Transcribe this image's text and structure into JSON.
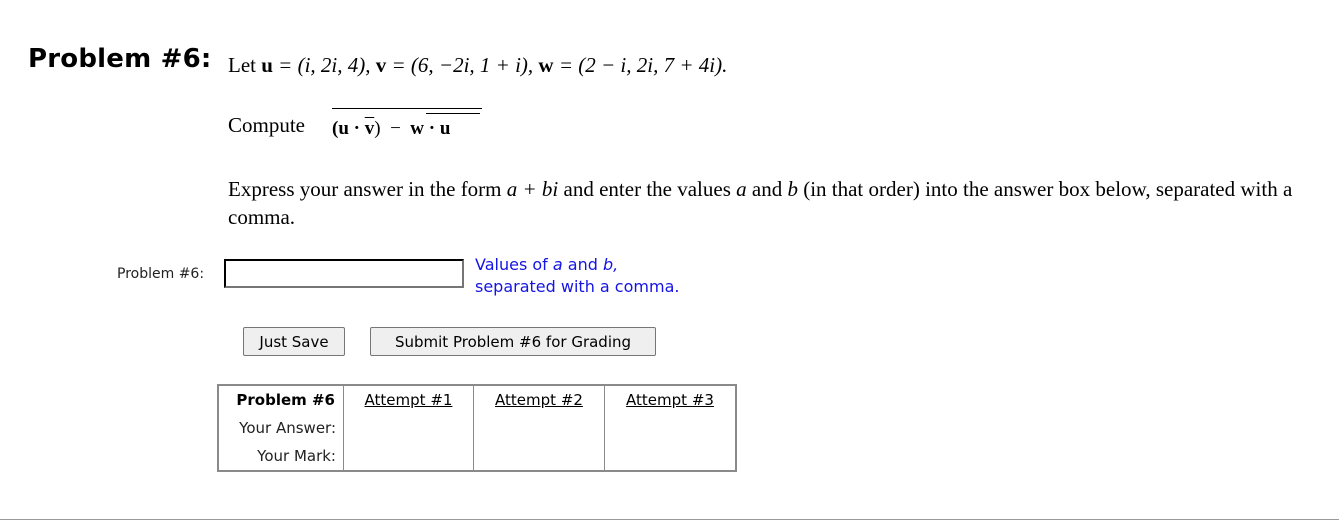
{
  "problem": {
    "heading": "Problem #6:",
    "statement": {
      "let_word": "Let",
      "u_name": "u",
      "u_value": "= (i, 2i, 4),",
      "v_name": "v",
      "v_value": "= (6, −2i, 1 + i),",
      "w_name": "w",
      "w_value": "= (2 − i, 2i, 7 + 4i)."
    },
    "compute_label": "Compute",
    "expression": {
      "open_u": "(u ·",
      "v_bar": "v",
      "close": ")",
      "minus": "−",
      "w_dot_u": "w · u"
    },
    "instructions": {
      "part1": "Express your answer in the form",
      "form": "a + bi",
      "part2": "and enter the values",
      "a": "a",
      "and": "and",
      "b": "b",
      "part3": "(in that order) into the answer box below, separated with a comma."
    }
  },
  "answer": {
    "label": "Problem #6:",
    "value": "",
    "hint_line1_pre": "Values of",
    "hint_a": "a",
    "hint_and": "and",
    "hint_b": "b,",
    "hint_line2": "separated with a comma."
  },
  "buttons": {
    "save": "Just Save",
    "submit": "Submit Problem #6 for Grading"
  },
  "attempts_table": {
    "header": "Problem #6",
    "attempts": [
      "Attempt #1",
      "Attempt #2",
      "Attempt #3"
    ],
    "row_labels": [
      "Your Answer:",
      "Your Mark:"
    ],
    "answers": [
      "",
      "",
      ""
    ],
    "marks": [
      "",
      "",
      ""
    ]
  }
}
